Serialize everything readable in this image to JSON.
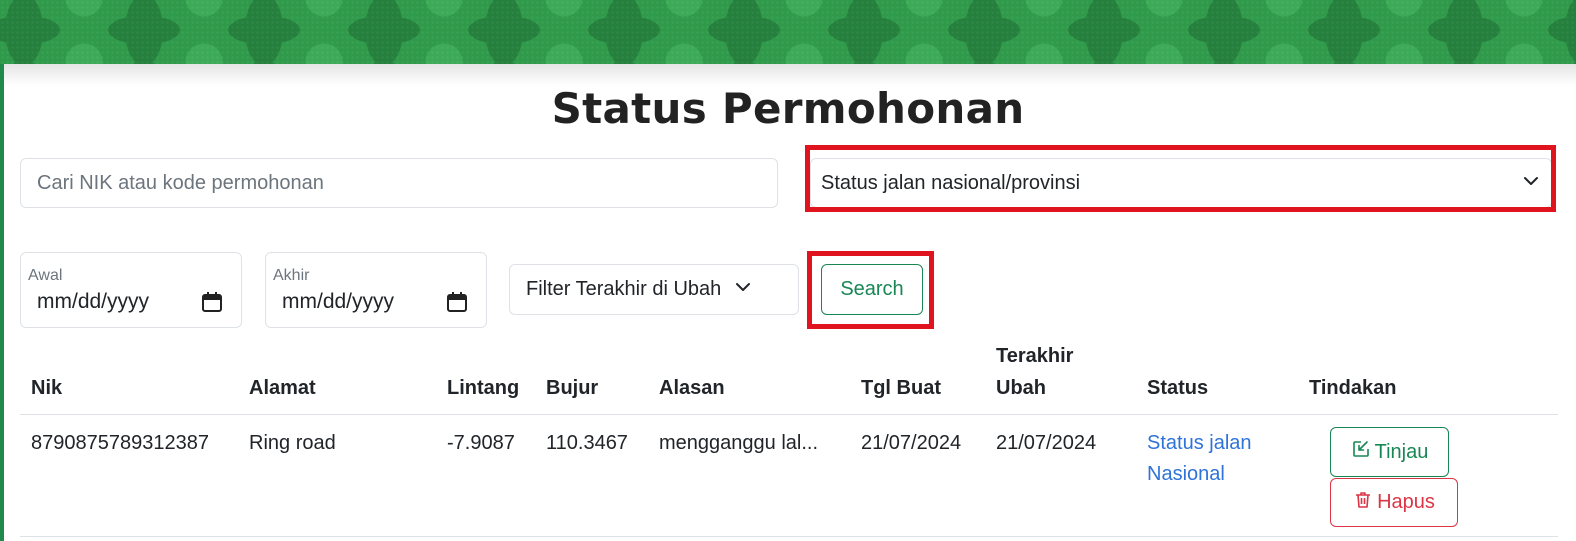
{
  "page": {
    "title": "Status Permohonan"
  },
  "filters": {
    "search_placeholder": "Cari NIK atau kode permohonan",
    "status_select_value": "Status jalan nasional/provinsi",
    "date_start_label": "Awal",
    "date_start_value": "mm/dd/yyyy",
    "date_end_label": "Akhir",
    "date_end_value": "mm/dd/yyyy",
    "sort_select_value": "Filter Terakhir di Ubah",
    "search_button": "Search"
  },
  "table": {
    "headers": {
      "nik": "Nik",
      "alamat": "Alamat",
      "lintang": "Lintang",
      "bujur": "Bujur",
      "alasan": "Alasan",
      "tgl_buat": "Tgl Buat",
      "terakhir_1": "Terakhir",
      "terakhir_2": "Ubah",
      "status": "Status",
      "tindakan": "Tindakan"
    },
    "rows": [
      {
        "nik": "8790875789312387",
        "alamat": "Ring road",
        "lintang": "-7.9087",
        "bujur": "110.3467",
        "alasan": "mengganggu lal...",
        "tgl_buat": "21/07/2024",
        "terakhir_ubah": "21/07/2024",
        "status_line1": "Status jalan",
        "status_line2": "Nasional",
        "action_review": "Tinjau",
        "action_delete": "Hapus"
      }
    ]
  },
  "colors": {
    "banner_green": "#2f9a4a",
    "success": "#198754",
    "danger": "#dc3545",
    "link": "#2f73d9",
    "highlight": "#e0141e"
  },
  "icons": {
    "status_select": "chevron-down-icon",
    "sort_select": "chevron-down-icon",
    "date_picker": "calendar-icon",
    "review": "edit-icon",
    "delete": "trash-icon"
  }
}
